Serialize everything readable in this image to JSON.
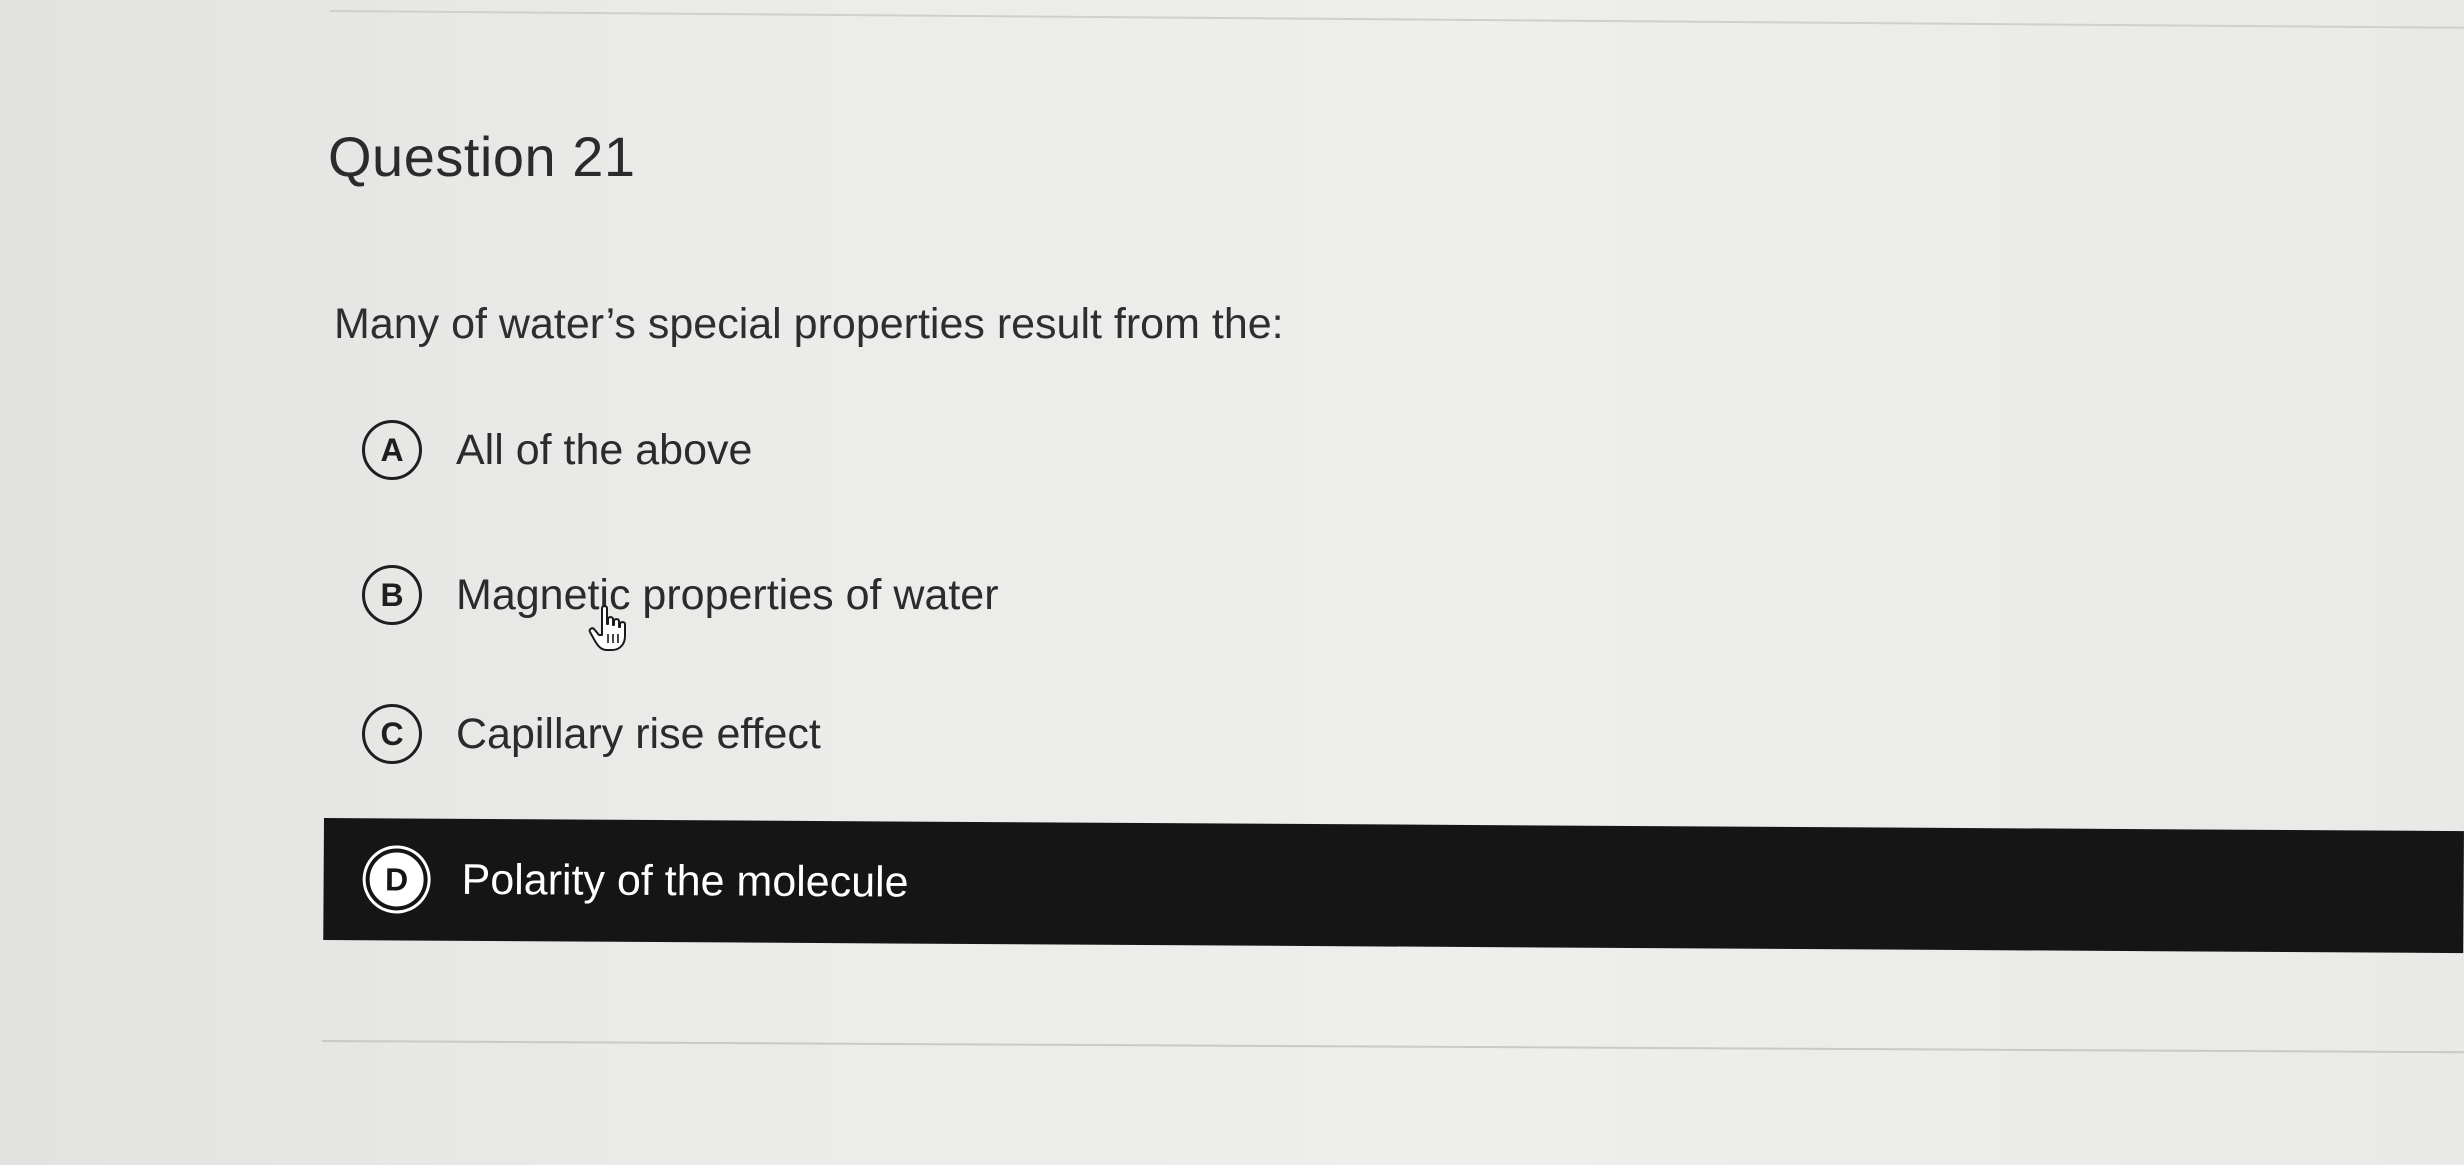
{
  "question": {
    "title": "Question 21",
    "prompt": "Many of water’s special properties result from the:"
  },
  "options": [
    {
      "letter": "A",
      "text": "All of the above",
      "selected": false
    },
    {
      "letter": "B",
      "text": "Magnetic properties of water",
      "selected": false
    },
    {
      "letter": "C",
      "text": "Capillary rise effect",
      "selected": false
    },
    {
      "letter": "D",
      "text": "Polarity of the molecule",
      "selected": true
    }
  ],
  "colors": {
    "background": "#ebebe9",
    "text": "#2b2b2b",
    "selected_background": "#151515",
    "selected_text": "#ffffff"
  },
  "icons": {
    "cursor": "hand-pointer-icon"
  }
}
